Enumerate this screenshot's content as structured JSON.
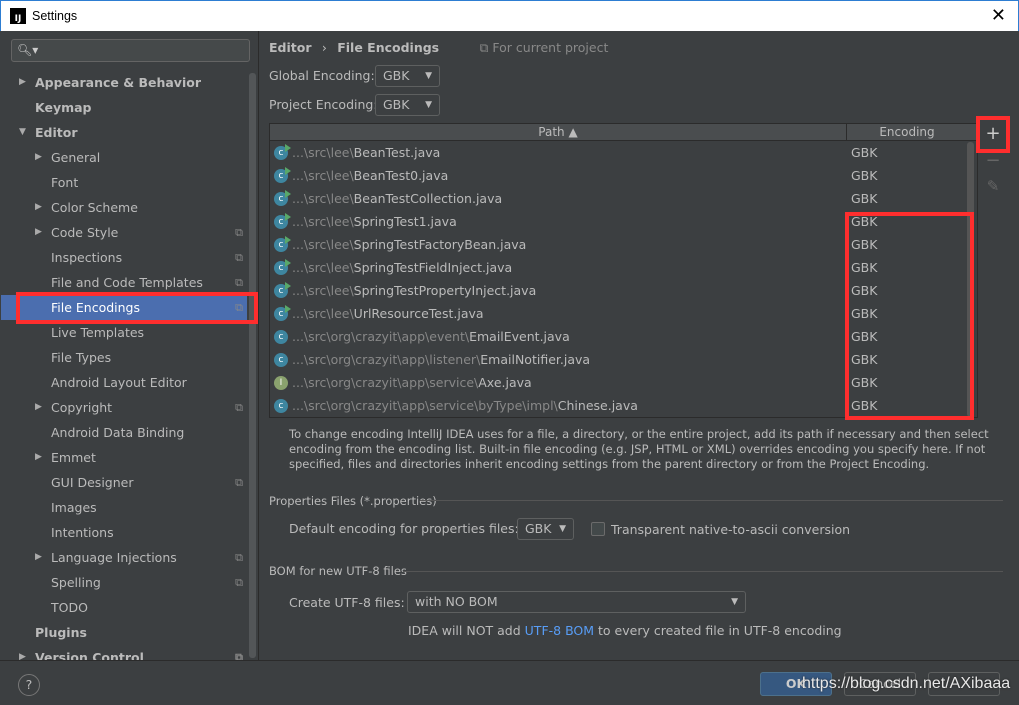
{
  "window": {
    "title": "Settings",
    "close": "✕"
  },
  "sidebar": {
    "search_placeholder": "",
    "items": [
      {
        "label": "Appearance & Behavior",
        "level": 0,
        "arrow": "▶"
      },
      {
        "label": "Keymap",
        "level": 0,
        "arrow": ""
      },
      {
        "label": "Editor",
        "level": 0,
        "arrow": "▼"
      },
      {
        "label": "General",
        "level": 1,
        "arrow": "▶"
      },
      {
        "label": "Font",
        "level": 1,
        "arrow": ""
      },
      {
        "label": "Color Scheme",
        "level": 1,
        "arrow": "▶"
      },
      {
        "label": "Code Style",
        "level": 1,
        "arrow": "▶",
        "project": true
      },
      {
        "label": "Inspections",
        "level": 1,
        "arrow": "",
        "project": true
      },
      {
        "label": "File and Code Templates",
        "level": 1,
        "arrow": "",
        "project": true
      },
      {
        "label": "File Encodings",
        "level": 1,
        "arrow": "",
        "project": true,
        "selected": true
      },
      {
        "label": "Live Templates",
        "level": 1,
        "arrow": ""
      },
      {
        "label": "File Types",
        "level": 1,
        "arrow": ""
      },
      {
        "label": "Android Layout Editor",
        "level": 1,
        "arrow": ""
      },
      {
        "label": "Copyright",
        "level": 1,
        "arrow": "▶",
        "project": true
      },
      {
        "label": "Android Data Binding",
        "level": 1,
        "arrow": ""
      },
      {
        "label": "Emmet",
        "level": 1,
        "arrow": "▶"
      },
      {
        "label": "GUI Designer",
        "level": 1,
        "arrow": "",
        "project": true
      },
      {
        "label": "Images",
        "level": 1,
        "arrow": ""
      },
      {
        "label": "Intentions",
        "level": 1,
        "arrow": ""
      },
      {
        "label": "Language Injections",
        "level": 1,
        "arrow": "▶",
        "project": true
      },
      {
        "label": "Spelling",
        "level": 1,
        "arrow": "",
        "project": true
      },
      {
        "label": "TODO",
        "level": 1,
        "arrow": ""
      },
      {
        "label": "Plugins",
        "level": 0,
        "arrow": ""
      },
      {
        "label": "Version Control",
        "level": 0,
        "arrow": "▶",
        "project": true
      }
    ]
  },
  "main": {
    "breadcrumb": {
      "parent": "Editor",
      "sep": "›",
      "current": "File Encodings",
      "scope": "For current project"
    },
    "global_encoding": {
      "label": "Global Encoding:",
      "value": "GBK"
    },
    "project_encoding": {
      "label": "Project Encoding:",
      "value": "GBK"
    },
    "table": {
      "columns": [
        "Path ▲",
        "Encoding"
      ],
      "rows": [
        {
          "dir": "...\\src\\lee\\",
          "file": "BeanTest.java",
          "enc": "GBK",
          "icon": "c-run"
        },
        {
          "dir": "...\\src\\lee\\",
          "file": "BeanTest0.java",
          "enc": "GBK",
          "icon": "c-run"
        },
        {
          "dir": "...\\src\\lee\\",
          "file": "BeanTestCollection.java",
          "enc": "GBK",
          "icon": "c-run"
        },
        {
          "dir": "...\\src\\lee\\",
          "file": "SpringTest1.java",
          "enc": "GBK",
          "icon": "c-run"
        },
        {
          "dir": "...\\src\\lee\\",
          "file": "SpringTestFactoryBean.java",
          "enc": "GBK",
          "icon": "c-run"
        },
        {
          "dir": "...\\src\\lee\\",
          "file": "SpringTestFieldInject.java",
          "enc": "GBK",
          "icon": "c-run"
        },
        {
          "dir": "...\\src\\lee\\",
          "file": "SpringTestPropertyInject.java",
          "enc": "GBK",
          "icon": "c-run"
        },
        {
          "dir": "...\\src\\lee\\",
          "file": "UrlResourceTest.java",
          "enc": "GBK",
          "icon": "c-run"
        },
        {
          "dir": "...\\src\\org\\crazyit\\app\\event\\",
          "file": "EmailEvent.java",
          "enc": "GBK",
          "icon": "c"
        },
        {
          "dir": "...\\src\\org\\crazyit\\app\\listener\\",
          "file": "EmailNotifier.java",
          "enc": "GBK",
          "icon": "c"
        },
        {
          "dir": "...\\src\\org\\crazyit\\app\\service\\",
          "file": "Axe.java",
          "enc": "GBK",
          "icon": "i"
        },
        {
          "dir": "...\\src\\org\\crazyit\\app\\service\\byType\\impl\\",
          "file": "Chinese.java",
          "enc": "GBK",
          "icon": "c"
        }
      ]
    },
    "tools": {
      "add": "+",
      "remove": "−",
      "edit": "✎"
    },
    "note": "To change encoding IntelliJ IDEA uses for a file, a directory, or the entire project, add its path if necessary and then select encoding from the encoding list. Built-in file encoding (e.g. JSP, HTML or XML) overrides encoding you specify here. If not specified, files and directories inherit encoding settings from the parent directory or from the Project Encoding.",
    "properties": {
      "section": "Properties Files (*.properties)",
      "default_label": "Default encoding for properties files:",
      "default_value": "GBK",
      "native_label": "Transparent native-to-ascii conversion",
      "native_checked": false
    },
    "bom": {
      "section": "BOM for new UTF-8 files",
      "create_label": "Create UTF-8 files:",
      "create_value": "with NO BOM",
      "info_pre": "IDEA will NOT add ",
      "info_link": "UTF-8 BOM",
      "info_post": " to every created file in UTF-8 encoding"
    }
  },
  "footer": {
    "help": "?",
    "ok": "OK",
    "cancel": "Cancel",
    "apply": ""
  },
  "watermark": "https://blog.csdn.net/AXibaaa",
  "colors": {
    "selection": "#4b6eaf",
    "highlight": "#ff2e2e",
    "link": "#589df6"
  }
}
